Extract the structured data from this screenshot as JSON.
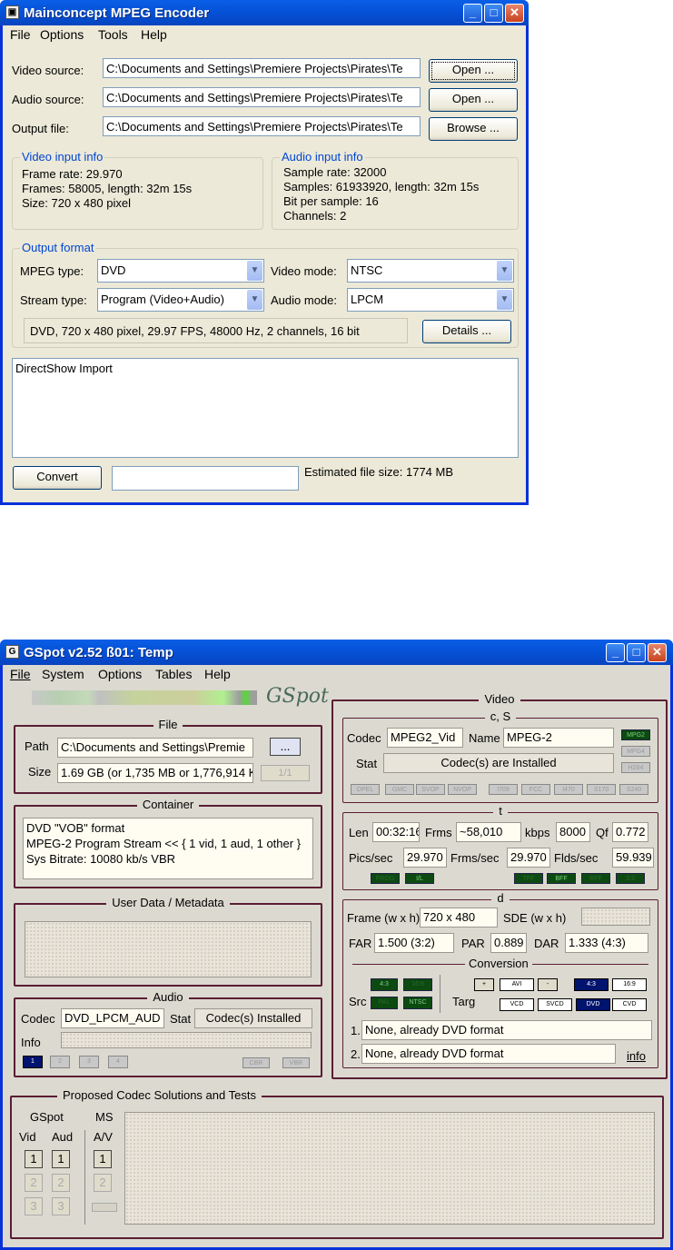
{
  "mc": {
    "title": "Mainconcept MPEG Encoder",
    "menu": [
      "File",
      "Options",
      "Tools",
      "Help"
    ],
    "video_label": "Video source:",
    "video_value": "C:\\Documents and Settings\\Premiere Projects\\Pirates\\Te",
    "audio_label": "Audio source:",
    "audio_value": "C:\\Documents and Settings\\Premiere Projects\\Pirates\\Te",
    "output_label": "Output file:",
    "output_value": "C:\\Documents and Settings\\Premiere Projects\\Pirates\\Te",
    "open1": "Open ...",
    "open2": "Open ...",
    "browse": "Browse ...",
    "vinfo_title": "Video input info",
    "vinfo": [
      "Frame rate: 29.970",
      "Frames: 58005, length: 32m 15s",
      "Size: 720 x 480 pixel"
    ],
    "ainfo_title": "Audio input info",
    "ainfo": [
      "Sample rate: 32000",
      "Samples: 61933920, length: 32m 15s",
      "Bit per sample: 16",
      "Channels: 2"
    ],
    "of_title": "Output format",
    "mpeg_type_label": "MPEG type:",
    "mpeg_type": "DVD",
    "stream_type_label": "Stream type:",
    "stream_type": "Program (Video+Audio)",
    "video_mode_label": "Video mode:",
    "video_mode": "NTSC",
    "audio_mode_label": "Audio mode:",
    "audio_mode": "LPCM",
    "summary": "DVD, 720 x 480 pixel, 29.97 FPS, 48000 Hz, 2 channels, 16 bit",
    "details": "Details ...",
    "log": "DirectShow Import",
    "convert": "Convert",
    "est": "Estimated file size: 1774 MB"
  },
  "gs": {
    "title": "GSpot v2.52 ß01: Temp",
    "menu": [
      "File",
      "System",
      "Options",
      "Tables",
      "Help"
    ],
    "logo": "GSpot",
    "file_h": "File",
    "path_l": "Path",
    "path_v": "C:\\Documents and Settings\\Premie",
    "browse": "...",
    "size_l": "Size",
    "size_v": "1.69 GB (or 1,735 MB or 1,776,914 K",
    "pages": "1/1",
    "container_h": "Container",
    "container": [
      "DVD \"VOB\" format",
      "MPEG-2 Program Stream << { 1 vid, 1 aud, 1 other }",
      "Sys Bitrate: 10080 kb/s VBR"
    ],
    "ud_h": "User Data / Metadata",
    "audio_h": "Audio",
    "codec_l": "Codec",
    "codec_v": "DVD_LPCM_AUD",
    "stat_l": "Stat",
    "stat_v": "Codec(s) Installed",
    "info_l": "Info",
    "audio_tabs": [
      "1",
      "2",
      "3",
      "4"
    ],
    "cbr": "CBR",
    "vbr": "VBR",
    "video_h": "Video",
    "cs_h": "c, S",
    "vcodec_l": "Codec",
    "vcodec_v": "MPEG2_Vid",
    "vname_l": "Name",
    "vname_v": "MPEG-2",
    "vstat_l": "Stat",
    "vstat_v": "Codec(s) are Installed",
    "codec_tags": [
      "MPG2",
      "MPG4",
      "H264"
    ],
    "fourcc": [
      "OPEL",
      "GMC",
      "SVOP",
      "NVOP",
      "I709",
      "FCC",
      "I470",
      "S170",
      "S240"
    ],
    "t_h": "t",
    "len_l": "Len",
    "len_v": "00:32:16",
    "frms_l": "Frms",
    "frms_v": "~58,010",
    "kbps_l": "kbps",
    "kbps_v": "8000",
    "qf_l": "Qf",
    "qf_v": "0.772",
    "pics_l": "Pics/sec",
    "pics_v": "29.970",
    "frmsec_l": "Frms/sec",
    "frmsec_v": "29.970",
    "flds_l": "Flds/sec",
    "flds_v": "59.939",
    "t_tags": [
      "PROG",
      "I/L",
      "TFF",
      "BFF",
      "RFF",
      "3:2"
    ],
    "d_h": "d",
    "frame_l": "Frame (w x h)",
    "frame_v": "720 x 480",
    "sde_l": "SDE (w x h)",
    "far_l": "FAR",
    "far_v": "1.500 (3:2)",
    "par_l": "PAR",
    "par_v": "0.889",
    "dar_l": "DAR",
    "dar_v": "1.333 (4:3)",
    "conv_h": "Conversion",
    "src_l": "Src",
    "src_tags": [
      "4:3",
      "16:9",
      "PAL",
      "NTSC"
    ],
    "targ_l": "Targ",
    "targ_tags": [
      "+",
      "AVI",
      "-",
      "4:3",
      "16:9",
      "VCD",
      "SVCD",
      "DVD",
      "CVD"
    ],
    "n1": "1.",
    "c1": "None, already DVD format",
    "n2": "2.",
    "c2": "None, already DVD format",
    "info_link": "info",
    "pcs_h": "Proposed Codec Solutions and Tests",
    "gspot_l": "GSpot",
    "ms_l": "MS",
    "vid_l": "Vid",
    "aud_l": "Aud",
    "av_l": "A/V",
    "nums": [
      "1",
      "2",
      "3"
    ]
  }
}
